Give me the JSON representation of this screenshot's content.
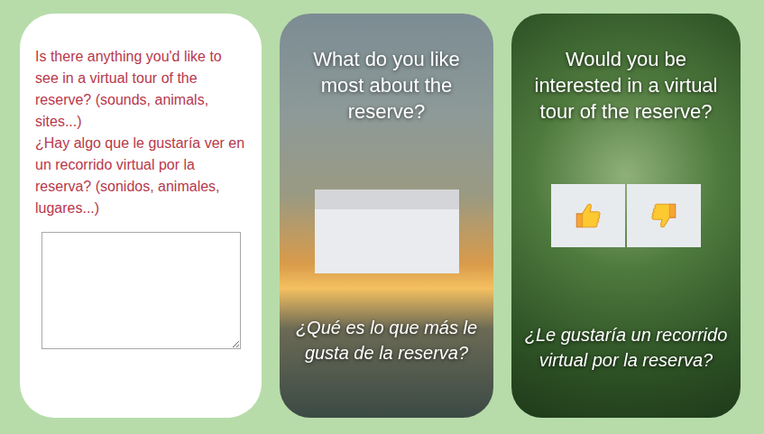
{
  "question_card": {
    "prompt_en": "Is there anything you'd like to see in a virtual tour of the reserve? (sounds, animals, sites...)",
    "prompt_es": "¿Hay algo que le gustaría ver en un recorrido virtual por la reserva? (sonidos, animales, lugares...)",
    "value": ""
  },
  "favorite_card": {
    "title": "What do you like most about the reserve?",
    "input_value": "",
    "subtitle": "¿Qué es lo que más le gusta de la reserva?"
  },
  "tour_card": {
    "title": "Would you be interested in a virtual tour of the reserve?",
    "options": [
      {
        "kind": "up",
        "selected": false
      },
      {
        "kind": "down",
        "selected": false
      }
    ],
    "subtitle": "¿Le gustaría un recorrido virtual por la reserva?"
  }
}
